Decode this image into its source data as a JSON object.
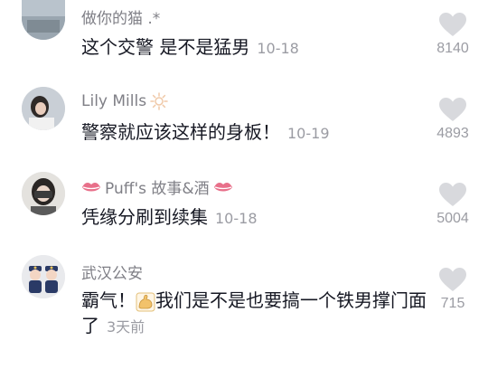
{
  "comments": [
    {
      "username": "做你的猫 .*",
      "text": "这个交警 是不是猛男",
      "time": "10-18",
      "likes": "8140"
    },
    {
      "username": "Lily Mills",
      "text": "警察就应该这样的身板！",
      "time": "10-19",
      "likes": "4893"
    },
    {
      "username": "Puff's 故事&酒",
      "text": "凭缘分刷到续集",
      "time": "10-18",
      "likes": "5004"
    },
    {
      "username": "武汉公安",
      "text_part1": "霸气！",
      "text_part2": "我们是不是也要搞一个铁男撑门面了",
      "time": "3天前",
      "likes": "715"
    }
  ],
  "colors": {
    "username": "#7f7f86",
    "text": "#161823",
    "muted": "#9b9ca3",
    "heart": "#d8d9dd",
    "lips": "#e8708a"
  },
  "icons": {
    "like": "heart-icon",
    "sun": "sun-icon",
    "lips": "lips-icon",
    "muscle": "flexed-biceps-icon"
  }
}
